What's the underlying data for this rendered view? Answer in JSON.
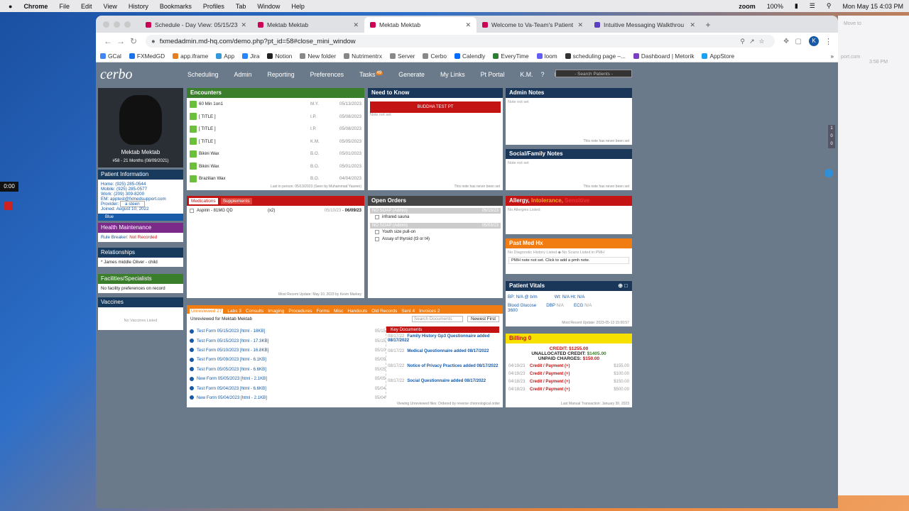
{
  "macbar": {
    "apple": "",
    "app": "Chrome",
    "menus": [
      "File",
      "Edit",
      "View",
      "History",
      "Bookmarks",
      "Profiles",
      "Tab",
      "Window",
      "Help"
    ],
    "right_icons": [
      "zoom",
      "100%",
      "battery",
      "wifi",
      "search",
      "control"
    ],
    "battery": "100%",
    "datetime": "Mon May 15  4:03 PM"
  },
  "recorder": {
    "time": "0:00"
  },
  "browser": {
    "tabs": [
      {
        "label": "Schedule - Day View: 05/15/23"
      },
      {
        "label": "Mektab Mektab"
      },
      {
        "label": "Mektab Mektab"
      },
      {
        "label": "Welcome to Va-Team's Patient"
      },
      {
        "label": "Intuitive Messaging Walkthrou"
      }
    ],
    "url": "fxmedadmin.md-hq.com/demo.php?pt_id=58#close_mini_window",
    "avatar": "K",
    "bookmarks": [
      "GCal",
      "FXMedGD",
      "app.iframe",
      "App",
      "Jira",
      "Notion",
      "New folder",
      "Nutrimentrx",
      "Server",
      "Cerbo",
      "Calendly",
      "EveryTime",
      "loom",
      "scheduling page –...",
      "Dashboard | Metorik",
      "AppStore"
    ],
    "behind": {
      "text": "Move to",
      "text2": "port.com",
      "time": "3:58 PM"
    }
  },
  "app": {
    "logo": "cerbo",
    "nav": [
      "Scheduling",
      "Admin",
      "Reporting",
      "Preferences",
      "Tasks",
      "Generate",
      "My Links",
      "Pt Portal",
      "K.M."
    ],
    "tasks_badge": "49",
    "search_placeholder": "- Search Patients -",
    "patient": {
      "name": "Mektab Mektab",
      "sub": "#58 - 21 Months (08/09/2021)"
    },
    "patient_info": {
      "title": "Patient Information",
      "lines": [
        "Home: (925) 285-0544",
        "Mobile: (925) 285-0577",
        "Work: (209) 309-8200",
        "EM: apptest@fxmedsupport.com",
        "Provider:",
        "Joined: August 10, 2022"
      ],
      "provider_value": "a steen",
      "tag": "Blue"
    },
    "health": {
      "title": "Health Maintenance",
      "label": "Rule Breaker:",
      "value": "Not Recorded"
    },
    "relationships": {
      "title": "Relationships",
      "text": "* James middle Oliver - child"
    },
    "facilities": {
      "title": "Facilities/Specialists",
      "text": "No facility preferences on record"
    },
    "vaccines": {
      "title": "Vaccines",
      "text": "No Vaccines Listed"
    },
    "encounters": {
      "title": "Encounters",
      "rows": [
        {
          "t": "60 Min 1on1",
          "i": "M.Y.",
          "d": "05/13/2023"
        },
        {
          "t": "[ TITLE ]",
          "i": "I.P.",
          "d": "05/08/2023"
        },
        {
          "t": "[ TITLE ]",
          "i": "I.P.",
          "d": "05/08/2023"
        },
        {
          "t": "[ TITLE ]",
          "i": "K.M.",
          "d": "05/05/2023"
        },
        {
          "t": "Bikini Wax",
          "i": "B.O.",
          "d": "05/01/2023"
        },
        {
          "t": "Bikini Wax",
          "i": "B.O.",
          "d": "05/01/2023"
        },
        {
          "t": "Brazilian Wax",
          "i": "B.O.",
          "d": "04/04/2023"
        }
      ],
      "footer": "Last in person: 05/13/2023 (Seen by Muhammad Yaseen)"
    },
    "need": {
      "title": "Need to Know",
      "alert": "BUDDHA TEST PT",
      "note": "Note not set",
      "footer": "This note has never been set"
    },
    "admin_notes": {
      "title": "Admin Notes",
      "note": "Note not set",
      "footer": "This note has never been set"
    },
    "social": {
      "title": "Social/Family Notes",
      "note": "Note not set",
      "footer": "This note has never been set"
    },
    "meds": {
      "tab1": "Medications",
      "tab2": "Supplements",
      "row": "Aspirin - 81MG QD",
      "qty": "(x2)",
      "date": "05/10/23",
      "date2": "06/09/23",
      "footer": "Most Recent Update: May 10, 2023 by Kevin Markey"
    },
    "orders": {
      "title": "Open Orders",
      "groups": [
        {
          "h": "NO SOAP (Admin)",
          "d": "05/15/23",
          "items": [
            "infrared sauna"
          ]
        },
        {
          "h": "NO SOAP (Admin)",
          "d": "05/03/23",
          "items": [
            "Youth size pull-on",
            "Assay of thyroid (t3 or t4)"
          ]
        }
      ]
    },
    "allergy": {
      "title": "Allergy,",
      "title2": "Intolerance,",
      "title3": "Sensitive",
      "text": "No Allergies Listed"
    },
    "pmh": {
      "title": "Past Med Hx",
      "text": "No Diagnostic History Listed  ◆  No Scans Listed in PMH",
      "note": "PMH note not set. Click to add a pmh note."
    },
    "vitals": {
      "title": "Patient Vitals",
      "bp": "BP: N/A @ b/m",
      "wt": "Wt: N/A",
      "ht": "Ht: N/A",
      "glucose": "Blood Glucose",
      "glucose_v": "3600",
      "dbp": "DBP",
      "dbp_v": "N/A",
      "ecg": "ECG",
      "ecg_v": "N/A",
      "footer": "Most Recent Update: 2023-05-13 15:00:57"
    },
    "docs": {
      "tabs": [
        "Unreviewed 27",
        "Labs 3",
        "Consults",
        "Imaging",
        "Procedures",
        "Forms",
        "Misc",
        "Handouts",
        "Old Records",
        "Sent 4",
        "Invoices 2"
      ],
      "heading": "Unreviewed for Mektab Mektab",
      "search": "Search Documents",
      "sort": "Newest First",
      "rows": [
        {
          "t": "Test Form 05/15/2023 [html - 18KB]",
          "d": "05/15"
        },
        {
          "t": "Test Form 05/15/2023 [html - 17.3KB]",
          "d": "05/15"
        },
        {
          "t": "Test Form 05/10/2023 [html - 16.8KB]",
          "d": "05/10"
        },
        {
          "t": "Test Form 05/09/2023 [html - 6.1KB]",
          "d": "05/09"
        },
        {
          "t": "Test Form 05/05/2023 [html - 6.6KB]",
          "d": "05/05"
        },
        {
          "t": "New Form 05/05/2023 [html - 2.1KB]",
          "d": "05/05"
        },
        {
          "t": "Test Form 05/04/2023 [html - 6.6KB]",
          "d": "05/04"
        },
        {
          "t": "New Form 05/04/2023 [html - 2.1KB]",
          "d": "05/04"
        }
      ],
      "key_title": "Key Documents",
      "keys": [
        {
          "d": "08/17/22",
          "t": "Family History Gp3 Questionnaire added 08/17/2022"
        },
        {
          "d": "08/17/22",
          "t": "Medical Questionnaire added 08/17/2022"
        },
        {
          "d": "08/17/22",
          "t": "Notice of Privacy Practices added 08/17/2022"
        },
        {
          "d": "08/17/22",
          "t": "Social Questionnaire added 08/17/2022"
        }
      ],
      "footer": "Viewing Unreviewed files: Ordered by reverse chronological order"
    },
    "billing": {
      "title": "Billing",
      "count": "0",
      "credit": "CREDIT: $1255.00",
      "unalloc_label": "UNALLOCATED CREDIT:",
      "unalloc": "$1405.00",
      "unpaid_label": "UNPAID CHARGES:",
      "unpaid": "$150.00",
      "rows": [
        {
          "d": "04/19/23",
          "t": "Credit / Payment (+)",
          "a": "$155.00"
        },
        {
          "d": "04/19/23",
          "t": "Credit / Payment (+)",
          "a": "$100.00"
        },
        {
          "d": "04/18/23",
          "t": "Credit / Payment (+)",
          "a": "$150.00"
        },
        {
          "d": "04/18/23",
          "t": "Credit / Payment (+)",
          "a": "$500.00"
        }
      ],
      "footer": "Last Manual Transaction: January 30, 2023"
    },
    "side_badges": [
      "1",
      "0",
      "0"
    ]
  }
}
